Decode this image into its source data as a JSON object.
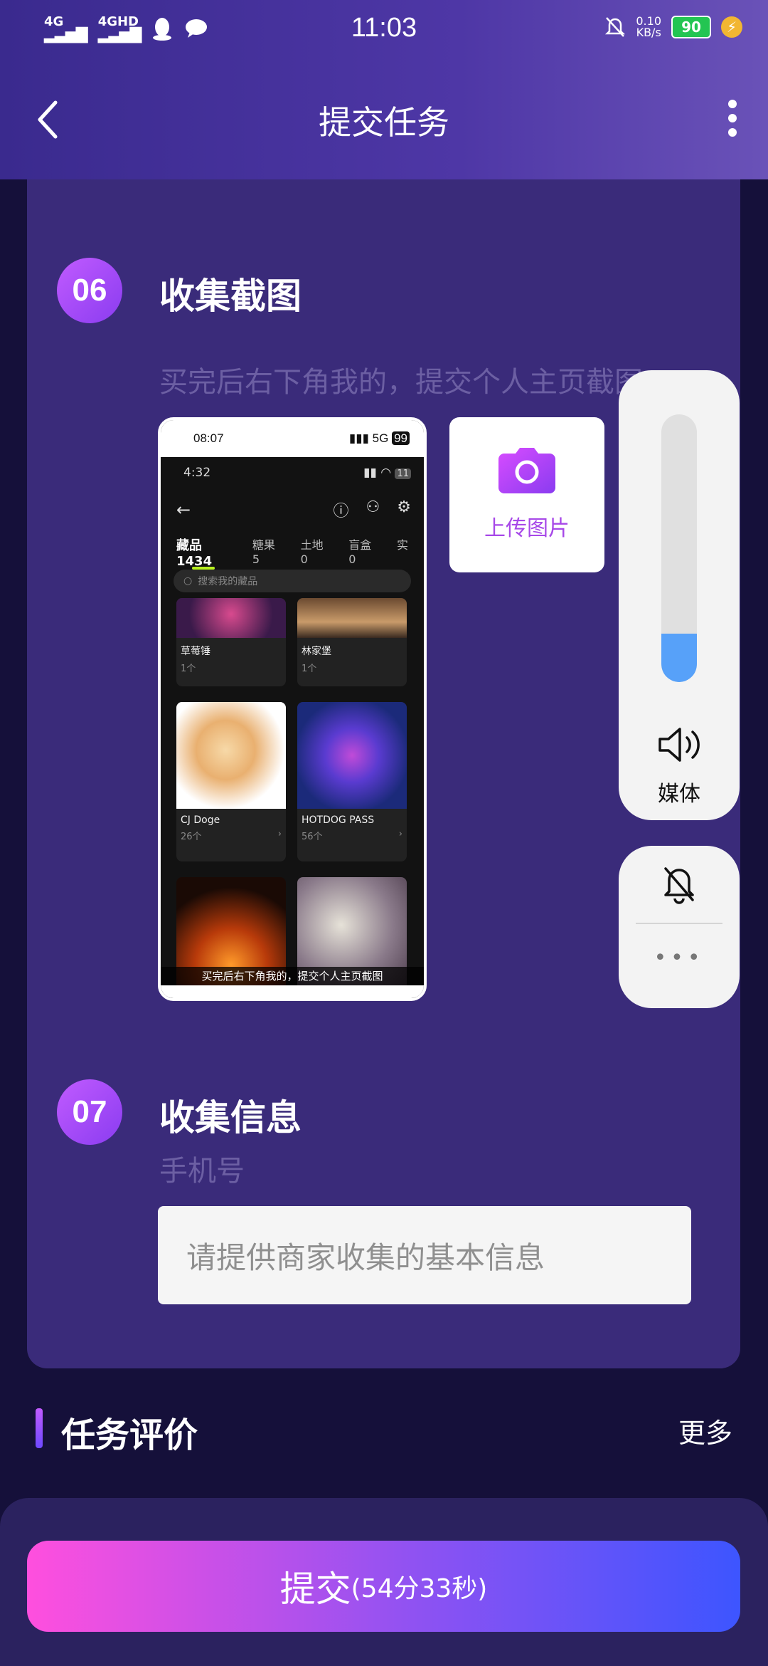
{
  "status": {
    "time": "11:03",
    "net1": "4G",
    "net2": "4GHD",
    "speed": "0.10",
    "speed_unit": "KB/s",
    "battery": "90"
  },
  "header": {
    "title": "提交任务"
  },
  "step6": {
    "num": "06",
    "title": "收集截图",
    "hint": "买完后右下角我的，提交个人主页截图",
    "upload_label": "上传图片",
    "screenshot": {
      "outer_time": "08:07",
      "outer_net": "5G",
      "outer_battery": "99",
      "inner_time": "4:32",
      "inner_battery": "11",
      "tabs": [
        "藏品1434",
        "糖果5",
        "土地0",
        "盲盒0",
        "实"
      ],
      "search_placeholder": "搜索我的藏品",
      "items": [
        {
          "name": "草莓锤",
          "count": "1个"
        },
        {
          "name": "林家堡",
          "count": "1个"
        },
        {
          "name": "CJ Doge",
          "count": "26个"
        },
        {
          "name": "HOTDOG PASS",
          "count": "56个"
        }
      ],
      "caption": "买完后右下角我的，提交个人主页截图"
    }
  },
  "step7": {
    "num": "07",
    "title": "收集信息",
    "label": "手机号",
    "placeholder": "请提供商家收集的基本信息"
  },
  "review": {
    "title": "任务评价",
    "more": "更多"
  },
  "submit": {
    "label": "提交",
    "timer": "(54分33秒)"
  },
  "volume": {
    "label": "媒体",
    "level_percent": 18,
    "more": "•••"
  },
  "colors": {
    "accent": "#a748e8",
    "slider": "#57a1f9",
    "card": "#3a2b7a"
  }
}
